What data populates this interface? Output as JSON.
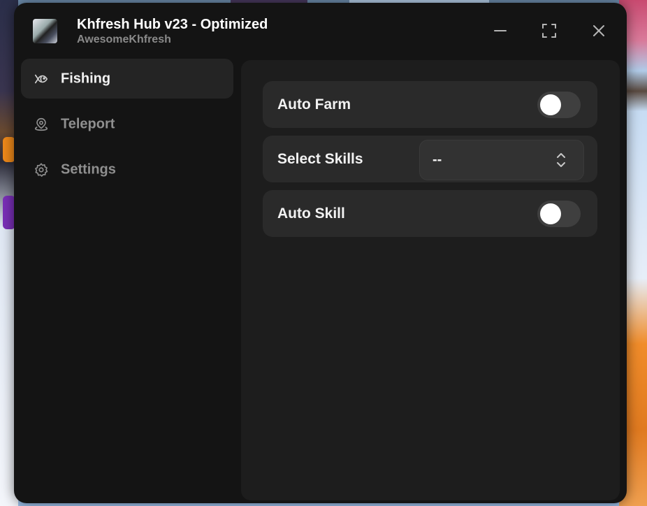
{
  "window": {
    "title": "Khfresh Hub v23 - Optimized",
    "subtitle": "AwesomeKhfresh",
    "controls": [
      "minimize-icon",
      "maximize-icon",
      "close-icon"
    ]
  },
  "sidebar": {
    "items": [
      {
        "label": "Fishing",
        "icon": "fish-icon",
        "active": true
      },
      {
        "label": "Teleport",
        "icon": "location-pin-icon",
        "active": false
      },
      {
        "label": "Settings",
        "icon": "gear-icon",
        "active": false
      }
    ]
  },
  "main": {
    "options": [
      {
        "label": "Auto Farm",
        "type": "toggle",
        "enabled": false
      },
      {
        "label": "Select Skills",
        "type": "dropdown",
        "value": "--"
      },
      {
        "label": "Auto Skill",
        "type": "toggle",
        "enabled": false
      }
    ]
  },
  "colors": {
    "window_bg": "#141414",
    "content_bg": "#1d1d1d",
    "row_bg": "#2a2a2a",
    "active_nav_bg": "#242424",
    "toggle_off": "#3f3f3f",
    "text_primary": "#f2f2f2",
    "text_muted": "#8f8f8f"
  }
}
